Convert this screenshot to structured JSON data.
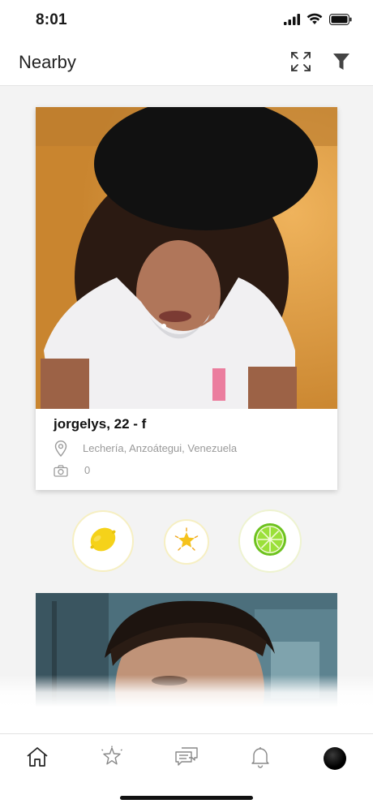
{
  "status_bar": {
    "time": "8:01"
  },
  "header": {
    "title": "Nearby",
    "expand_icon": "expand-icon",
    "filter_icon": "filter-icon"
  },
  "profile_card": {
    "name_line": "jorgelys, 22 - f",
    "location": "Lechería, Anzoátegui, Venezuela",
    "photo_count": "0",
    "location_icon": "map-pin-icon",
    "camera_icon": "camera-icon"
  },
  "actions": [
    {
      "name": "lemon",
      "icon": "lemon-icon",
      "color": "#f5d21a"
    },
    {
      "name": "star",
      "icon": "star-burst-icon",
      "color": "#f2b71b"
    },
    {
      "name": "lime",
      "icon": "lime-icon",
      "color": "#8cdc2a"
    }
  ],
  "tabbar": {
    "items": [
      "home-icon",
      "star-icon",
      "messages-icon",
      "bell-icon",
      "avatar"
    ]
  },
  "colors": {
    "background": "#f3f3f3",
    "card": "#ffffff",
    "accent_lemon": "#f5d21a",
    "accent_lime": "#8cdc2a"
  }
}
